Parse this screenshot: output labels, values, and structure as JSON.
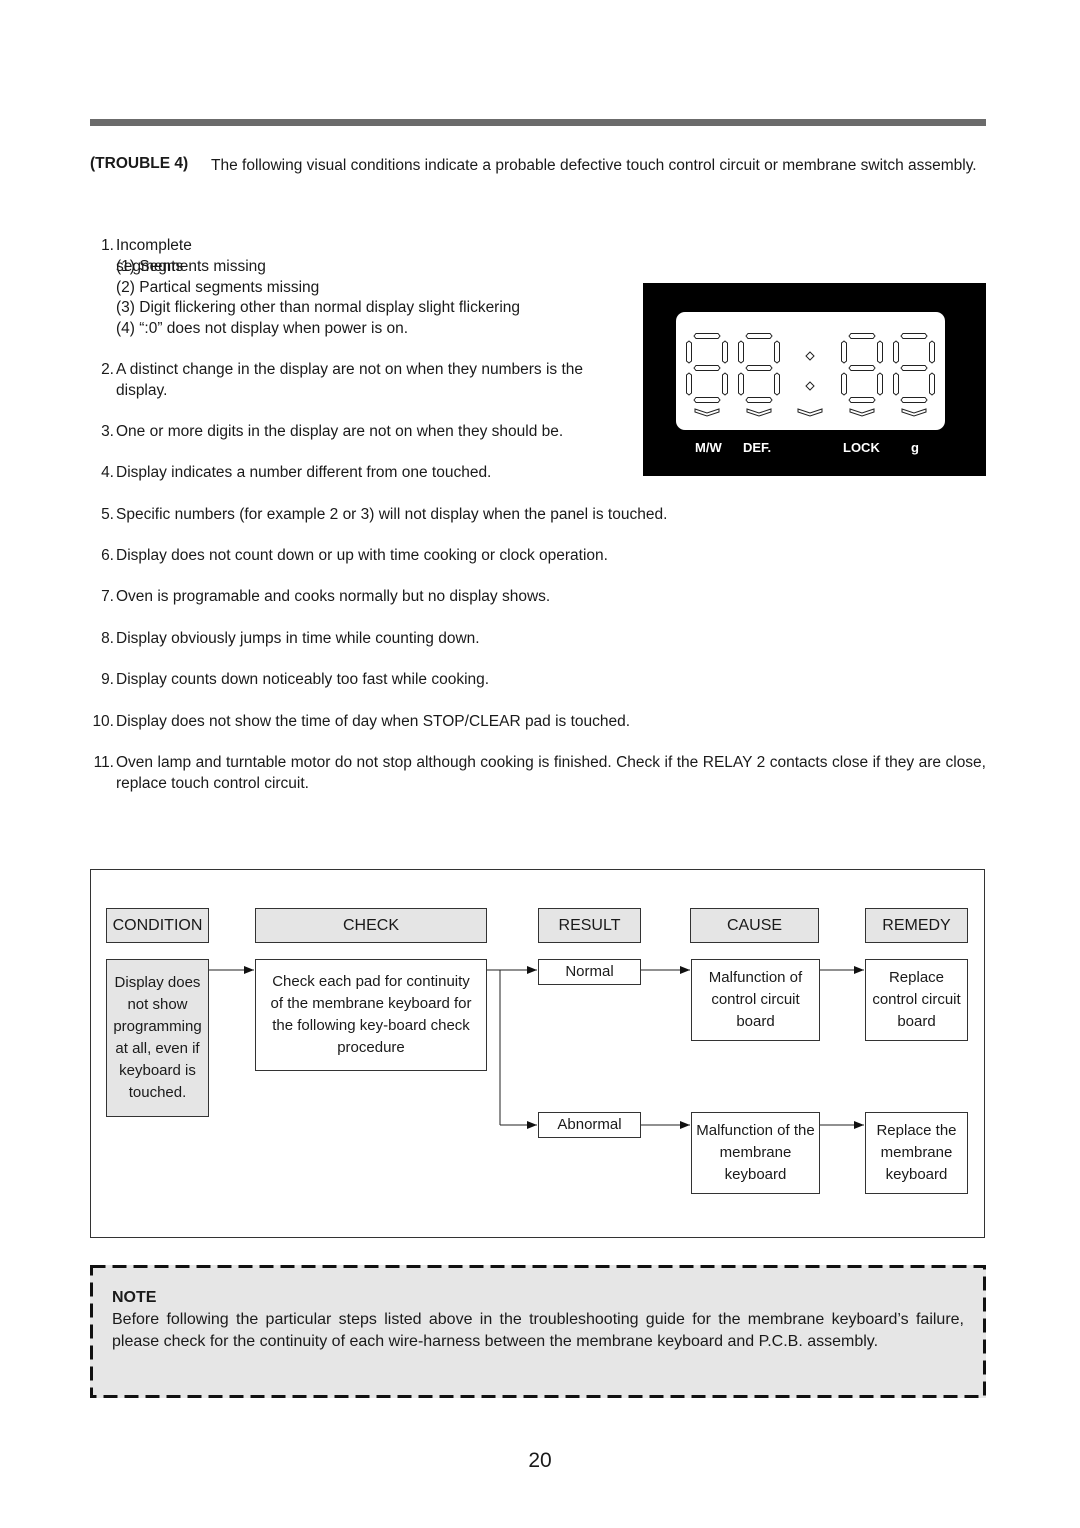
{
  "trouble": {
    "label": "(TROUBLE 4)",
    "text": "The following visual conditions indicate a probable defective touch control circuit or membrane switch assembly."
  },
  "conditions": [
    {
      "num": "1.",
      "text": "Incomplete segments",
      "subitems": [
        "(1) Segments missing",
        "(2) Partical segments missing",
        "(3) Digit flickering other than normal display slight flickering",
        "(4) “:0” does not display when power is on."
      ]
    },
    {
      "num": "2.",
      "text": "A distinct change in the display are not on when they numbers is the display."
    },
    {
      "num": "3.",
      "text": "One or more digits in the display are not on when they should be."
    },
    {
      "num": "4.",
      "text": "Display indicates a number different from one touched."
    },
    {
      "num": "5.",
      "text": "Specific numbers (for example 2 or 3) will not display when the panel is touched."
    },
    {
      "num": "6.",
      "text": "Display does not count down or up with time cooking or clock operation."
    },
    {
      "num": "7.",
      "text": "Oven is programable and cooks normally but no display shows."
    },
    {
      "num": "8.",
      "text": "Display obviously jumps in time while counting down."
    },
    {
      "num": "9.",
      "text": "Display counts down noticeably too fast while cooking."
    },
    {
      "num": "10.",
      "text": "Display does not show the time of day when STOP/CLEAR pad is touched."
    },
    {
      "num": "11.",
      "text": "Oven lamp and turntable motor do not stop although cooking is finished. Check if the RELAY 2 contacts close if they are close, replace touch control circuit."
    }
  ],
  "display_panel": {
    "labels": [
      "M/W",
      "DEF.",
      "LOCK",
      "g"
    ],
    "digits": "88:88"
  },
  "flowchart": {
    "headers": {
      "condition": "CONDITION",
      "check": "CHECK",
      "result": "RESULT",
      "cause": "CAUSE",
      "remedy": "REMEDY"
    },
    "condition": "Display does not show programming at all, even if keyboard is touched.",
    "check": "Check each pad for continuity of the membrane keyboard for the following key-board check procedure",
    "branches": [
      {
        "result": "Normal",
        "cause": "Malfunction of control circuit board",
        "remedy": "Replace control circuit board"
      },
      {
        "result": "Abnormal",
        "cause": "Malfunction of the membrane keyboard",
        "remedy": "Replace the membrane keyboard"
      }
    ]
  },
  "note": {
    "title": "NOTE",
    "text": "Before following the particular steps listed above in the troubleshooting guide for the membrane keyboard’s failure, please check for the continuity of each wire-harness between the membrane keyboard and P.C.B. assembly."
  },
  "page_number": "20"
}
